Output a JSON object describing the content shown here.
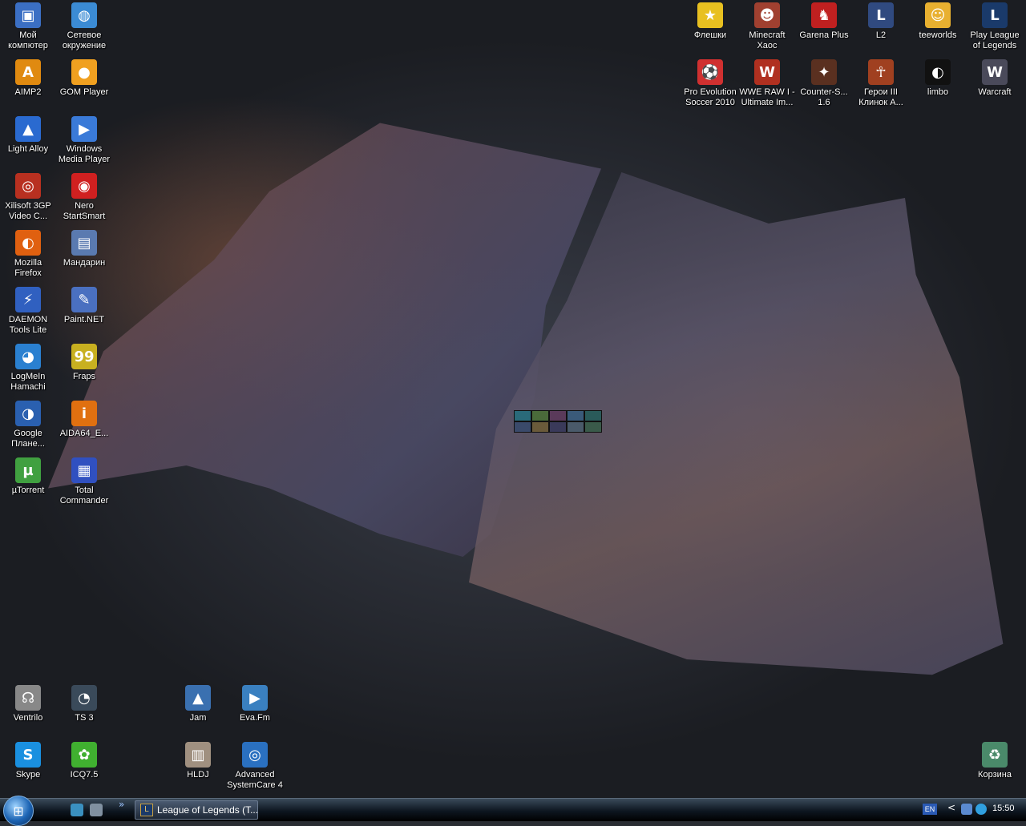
{
  "desktop_icons": [
    {
      "label": "Мой компютер",
      "icon": "computer-icon",
      "color": "#3b6fc4",
      "glyph": "▣"
    },
    {
      "label": "Сетевое окружение",
      "icon": "network-icon",
      "color": "#3b8bd4",
      "glyph": "◍"
    },
    {
      "label": "AIMP2",
      "icon": "aimp-icon",
      "color": "#e08a10",
      "glyph": "A"
    },
    {
      "label": "GOM Player",
      "icon": "gom-player-icon",
      "color": "#f0a020",
      "glyph": "●"
    },
    {
      "label": "Light Alloy",
      "icon": "light-alloy-icon",
      "color": "#2a6ad0",
      "glyph": "▲"
    },
    {
      "label": "Windows Media Player",
      "icon": "media-player-icon",
      "color": "#3a7ad8",
      "glyph": "▶"
    },
    {
      "label": "Xilisoft 3GP Video C...",
      "icon": "xilisoft-icon",
      "color": "#b83020",
      "glyph": "◎"
    },
    {
      "label": "Nero StartSmart",
      "icon": "nero-icon",
      "color": "#d02020",
      "glyph": "◉"
    },
    {
      "label": "Mozilla Firefox",
      "icon": "firefox-icon",
      "color": "#e06010",
      "glyph": "◐"
    },
    {
      "label": "Мандарин",
      "icon": "mandarin-icon",
      "color": "#5a7ab0",
      "glyph": "▤"
    },
    {
      "label": "DAEMON Tools Lite",
      "icon": "daemon-tools-icon",
      "color": "#3060c0",
      "glyph": "⚡"
    },
    {
      "label": "Paint.NET",
      "icon": "paint-net-icon",
      "color": "#4a70c0",
      "glyph": "✎"
    },
    {
      "label": "LogMeIn Hamachi",
      "icon": "hamachi-icon",
      "color": "#2a80d0",
      "glyph": "◕"
    },
    {
      "label": "Fraps",
      "icon": "fraps-icon",
      "color": "#c8b020",
      "glyph": "99"
    },
    {
      "label": "Google Плане...",
      "icon": "google-earth-icon",
      "color": "#2a60b0",
      "glyph": "◑"
    },
    {
      "label": "AIDA64_E...",
      "icon": "aida64-icon",
      "color": "#e07010",
      "glyph": "i"
    },
    {
      "label": "µTorrent",
      "icon": "utorrent-icon",
      "color": "#40a040",
      "glyph": "µ"
    },
    {
      "label": "Total Commander",
      "icon": "total-commander-icon",
      "color": "#3050c0",
      "glyph": "▦"
    },
    {
      "label": "Флешки",
      "icon": "star-icon",
      "color": "#e8c020",
      "glyph": "★"
    },
    {
      "label": "Minecraft Хаос",
      "icon": "minecraft-icon",
      "color": "#a04030",
      "glyph": "☻"
    },
    {
      "label": "Garena Plus",
      "icon": "garena-icon",
      "color": "#c02020",
      "glyph": "♞"
    },
    {
      "label": "L2",
      "icon": "lineage2-icon",
      "color": "#304a80",
      "glyph": "L"
    },
    {
      "label": "teeworlds",
      "icon": "teeworlds-icon",
      "color": "#e8b030",
      "glyph": "☺"
    },
    {
      "label": "Play League of Legends",
      "icon": "league-icon",
      "color": "#1a3a6a",
      "glyph": "L"
    },
    {
      "label": "Pro Evolution Soccer 2010",
      "icon": "pes-icon",
      "color": "#d03030",
      "glyph": "⚽"
    },
    {
      "label": "WWE RAW I - Ultimate Im...",
      "icon": "wwe-icon",
      "color": "#b03020",
      "glyph": "W"
    },
    {
      "label": "Counter-S... 1.6",
      "icon": "counter-strike-icon",
      "color": "#5a3020",
      "glyph": "✦"
    },
    {
      "label": "Герои III Клинок А...",
      "icon": "heroes-icon",
      "color": "#a04020",
      "glyph": "☥"
    },
    {
      "label": "limbo",
      "icon": "limbo-icon",
      "color": "#111111",
      "glyph": "◐"
    },
    {
      "label": "Warcraft",
      "icon": "warcraft-icon",
      "color": "#4a4a5a",
      "glyph": "W"
    },
    {
      "label": "Ventrilo",
      "icon": "ventrilo-icon",
      "color": "#888888",
      "glyph": "☊"
    },
    {
      "label": "TS 3",
      "icon": "teamspeak-icon",
      "color": "#3a4a5a",
      "glyph": "◔"
    },
    {
      "label": "Jam",
      "icon": "jam-icon",
      "color": "#3a70b0",
      "glyph": "▲"
    },
    {
      "label": "Eva.Fm",
      "icon": "evafm-icon",
      "color": "#3a80c0",
      "glyph": "▶"
    },
    {
      "label": "Skype",
      "icon": "skype-icon",
      "color": "#1a90e0",
      "glyph": "S"
    },
    {
      "label": "ICQ7.5",
      "icon": "icq-icon",
      "color": "#40b030",
      "glyph": "✿"
    },
    {
      "label": "HLDJ",
      "icon": "hldj-icon",
      "color": "#a09080",
      "glyph": "▥"
    },
    {
      "label": "Advanced SystemCare 4",
      "icon": "systemcare-icon",
      "color": "#2a70c0",
      "glyph": "◎"
    },
    {
      "label": "Корзина",
      "icon": "recycle-bin-icon",
      "color": "#4a8a6a",
      "glyph": "♻"
    }
  ],
  "taskbar": {
    "start_icon": "windows-start-icon",
    "quick_launch": [
      {
        "icon": "desktop-globe-icon",
        "color": "#3a90c0"
      },
      {
        "icon": "show-desktop-icon",
        "color": "#8090a0"
      }
    ],
    "quick_launch_more": "»",
    "task_title": "League of Legends (T...",
    "task_icon_glyph": "L",
    "language": "EN",
    "tray_arrow": "<",
    "tray_icons": [
      {
        "icon": "network-tray-icon",
        "color": "#5a8ad0"
      },
      {
        "icon": "volume-tray-icon",
        "color": "#30a0e0"
      }
    ],
    "clock": "15:50"
  }
}
